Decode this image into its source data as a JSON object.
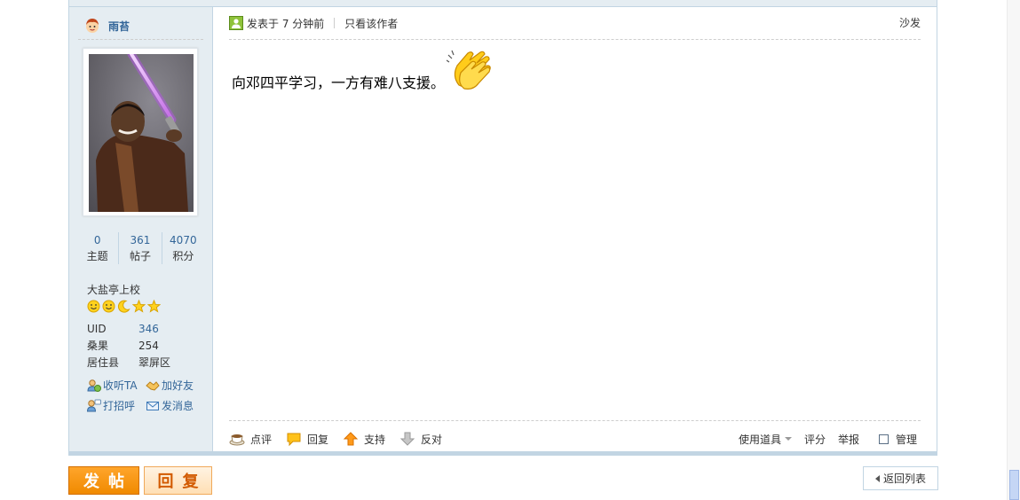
{
  "author": {
    "name": "雨苔",
    "stats": [
      {
        "value": "0",
        "label": "主题"
      },
      {
        "value": "361",
        "label": "帖子"
      },
      {
        "value": "4070",
        "label": "积分"
      }
    ],
    "rank": "大盐亭上校",
    "info": [
      {
        "key": "UID",
        "value": "346"
      },
      {
        "key": "桑果",
        "value": "254"
      },
      {
        "key": "居住县",
        "value": "翠屏区"
      }
    ],
    "actions": {
      "follow": "收听TA",
      "add_friend": "加好友",
      "greet": "打招呼",
      "message": "发消息"
    }
  },
  "post": {
    "time": "发表于 7 分钟前",
    "only_author": "只看该作者",
    "floor": "沙发",
    "message": "向邓四平学习，一方有难八支援。"
  },
  "footer": {
    "comment": "点评",
    "reply": "回复",
    "support": "支持",
    "oppose": "反对",
    "tools": "使用道具",
    "rate": "评分",
    "report": "举报",
    "manage": "管理"
  },
  "bottom": {
    "post_btn": "发帖",
    "reply_btn": "回复",
    "back_btn": "返回列表"
  },
  "colors": {
    "link": "#336699",
    "sidebar_bg": "#e5edf2",
    "border": "#c2d5e3",
    "post_button": "#f08a00"
  }
}
